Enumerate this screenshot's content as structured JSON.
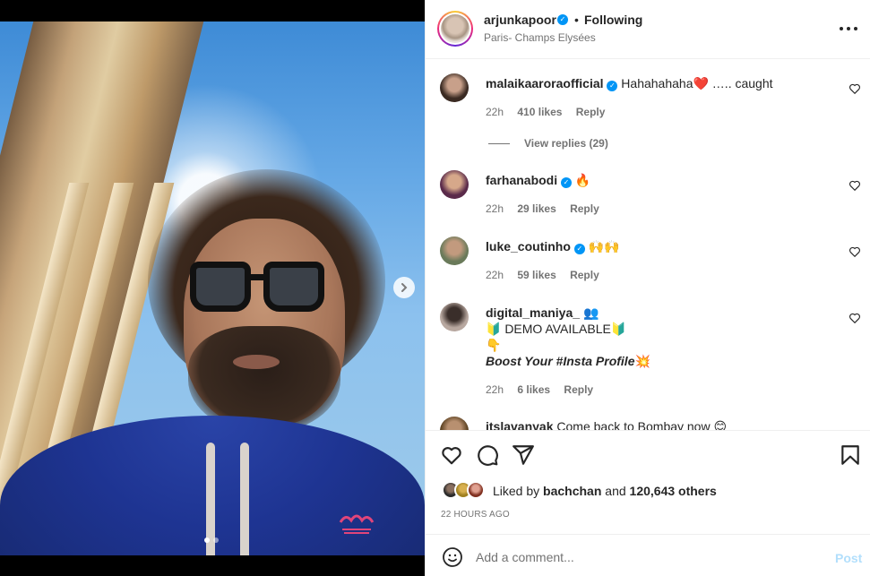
{
  "header": {
    "username": "arjunkapoor",
    "separator": "•",
    "follow_label": "Following",
    "location": "Paris- Champs Elysées",
    "verified_mark": "✓"
  },
  "comments": [
    {
      "username": "malaikaaroraofficial",
      "verified": true,
      "text_before": "Hahahahaha",
      "emoji": "❤️",
      "text_after": " ….. caught",
      "time": "22h",
      "likes": "410 likes",
      "reply": "Reply",
      "view_replies": "View replies (29)"
    },
    {
      "username": "farhanabodi",
      "verified": true,
      "emoji": "🔥",
      "time": "22h",
      "likes": "29 likes",
      "reply": "Reply"
    },
    {
      "username": "luke_coutinho",
      "verified": true,
      "emoji": "🙌🙌",
      "time": "22h",
      "likes": "59 likes",
      "reply": "Reply"
    },
    {
      "username": "digital_maniya_",
      "verified": false,
      "emoji_after_name": "👥",
      "line1": "🔰 DEMO AVAILABLE🔰",
      "line2": "👇",
      "line3": "Boost Your #Insta Profile",
      "line3_emoji": "💥",
      "time": "22h",
      "likes": "6 likes",
      "reply": "Reply"
    },
    {
      "username": "itslavanyak",
      "text": "Come back to Bombay now",
      "emoji": "😊"
    }
  ],
  "actions": {
    "liked_by_prefix": "Liked by",
    "liked_by_user": "bachchan",
    "liked_by_mid": "and",
    "liked_by_count": "120,643 others",
    "timestamp": "22 HOURS AGO"
  },
  "add_comment": {
    "placeholder": "Add a comment...",
    "post_label": "Post"
  },
  "colors": {
    "verified": "#0095f6",
    "heart": "#ed4956",
    "post_disabled": "#b2dffc",
    "muted": "#737373"
  },
  "icons": [
    "more-options-icon",
    "chevron-right-icon",
    "heart-icon",
    "comment-icon",
    "share-icon",
    "bookmark-icon",
    "emoji-icon"
  ]
}
